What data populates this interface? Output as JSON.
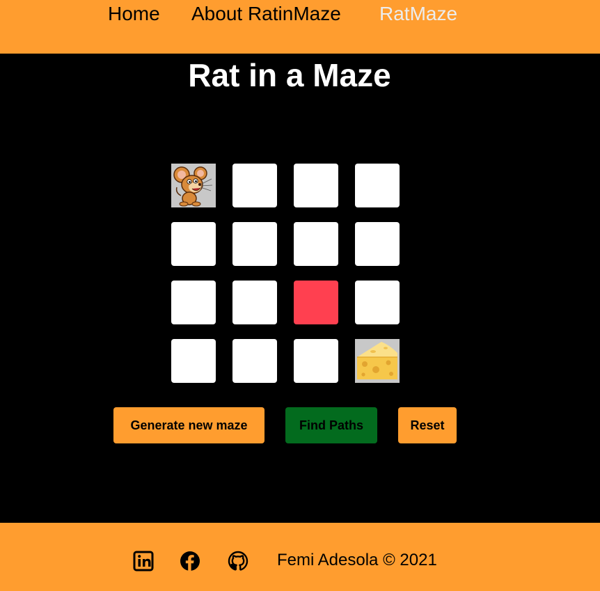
{
  "nav": {
    "items": [
      {
        "label": "Home"
      },
      {
        "label": "About RatinMaze"
      },
      {
        "label": "RatMaze"
      }
    ],
    "active": "RatMaze"
  },
  "page": {
    "title": "Rat in a Maze"
  },
  "maze": {
    "rows": 4,
    "cols": 4,
    "cells": [
      [
        "rat",
        "open",
        "open",
        "open"
      ],
      [
        "open",
        "open",
        "open",
        "open"
      ],
      [
        "open",
        "open",
        "wall",
        "open"
      ],
      [
        "open",
        "open",
        "open",
        "cheese"
      ]
    ]
  },
  "controls": {
    "generate_label": "Generate new maze",
    "find_label": "Find Paths",
    "reset_label": "Reset"
  },
  "footer": {
    "icons": [
      "linkedin-icon",
      "facebook-icon",
      "github-icon"
    ],
    "copyright": "Femi Adesola © 2021"
  },
  "colors": {
    "accent": "#ff9d2f",
    "wall": "#ff4050",
    "find_button": "#036b1e"
  }
}
